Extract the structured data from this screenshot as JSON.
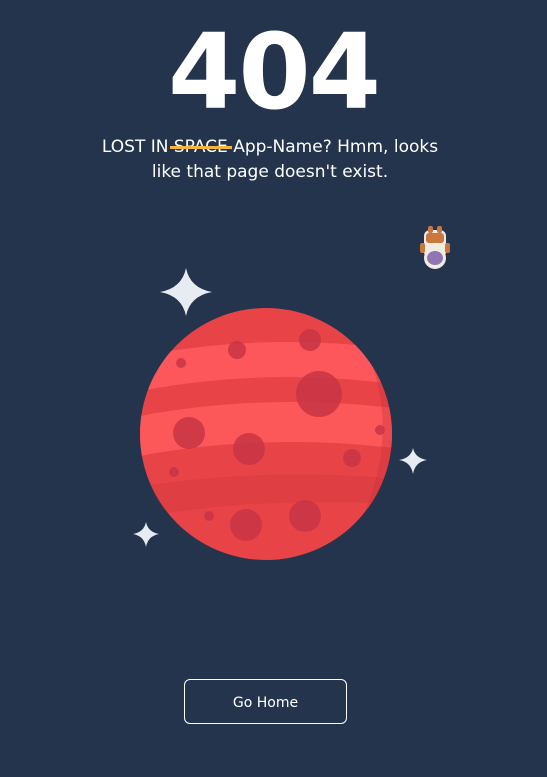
{
  "error": {
    "code": "404"
  },
  "message": {
    "prefix": "LOST IN",
    "struck_word": "SPACE",
    "suffix": "App-Name? Hmm, looks like that page doesn't exist."
  },
  "actions": {
    "home_label": "Go Home"
  },
  "colors": {
    "background": "#24344d",
    "planet": "#f14b4f",
    "strike": "#f5b640",
    "text": "#ffffff"
  },
  "icons": {
    "star": "star-sparkle-icon",
    "planet": "planet-illustration",
    "astronaut": "astronaut-icon"
  }
}
